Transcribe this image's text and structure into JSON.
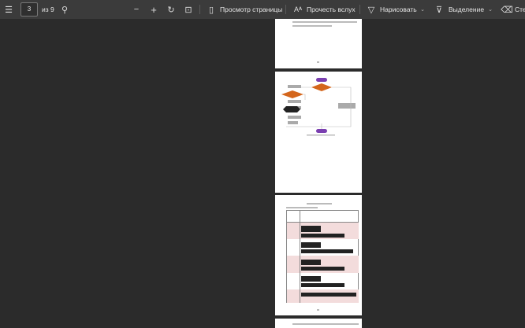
{
  "toolbar": {
    "page_number": "3",
    "page_total": "из 9",
    "page_view_label": "Просмотр страницы",
    "read_aloud_label": "Прочесть вслух",
    "draw_label": "Нарисовать",
    "highlight_label": "Выделение",
    "erase_label": "Сте"
  }
}
